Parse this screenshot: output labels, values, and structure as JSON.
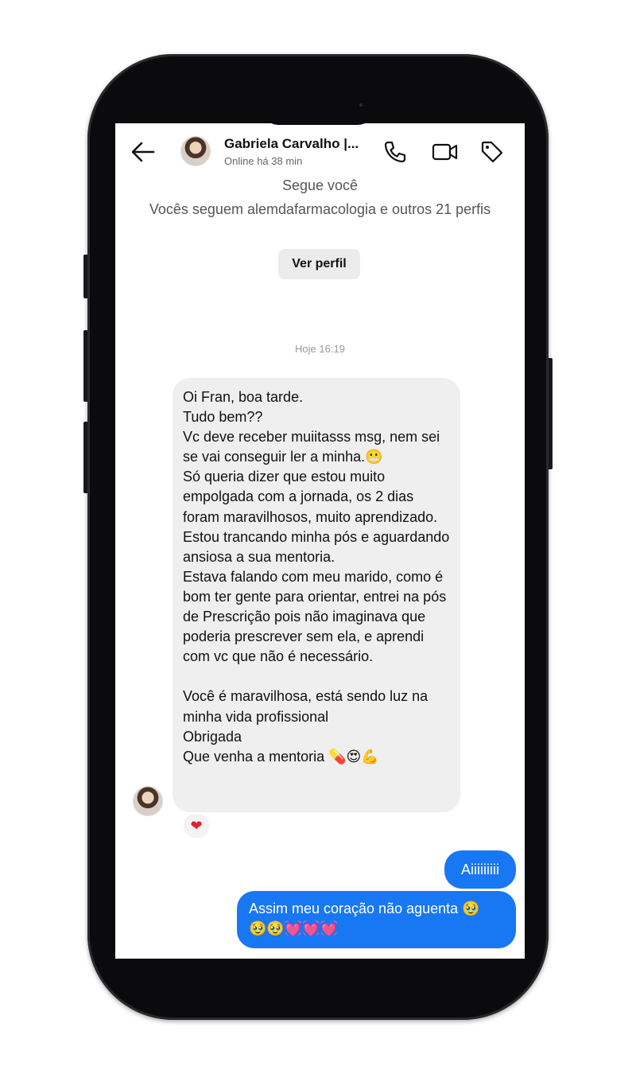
{
  "header": {
    "name": "Gabriela Carvalho |...",
    "status": "Online há 38 min"
  },
  "profile": {
    "follows_you": "Segue você",
    "mutual": "Vocês seguem alemdafarmacologia e outros 21 perfis",
    "view_profile_label": "Ver perfil"
  },
  "conversation": {
    "timestamp": "Hoje 16:19",
    "received_message": "Oi Fran, boa tarde.\nTudo bem??\nVc deve receber muiitasss msg, nem sei se vai conseguir ler a minha.😬\nSó queria dizer que estou muito empolgada com a jornada, os 2 dias foram maravilhosos, muito aprendizado.\nEstou trancando minha pós e aguardando ansiosa a sua mentoria.\nEstava falando com meu marido, como é bom ter gente para orientar, entrei na pós de Prescrição pois não imaginava que poderia prescrever sem ela, e aprendi com vc que não é necessário.\n\nVocê é maravilhosa, está sendo luz na minha vida profissional\nObrigada\nQue venha a mentoria 💊😍💪",
    "reaction": "❤",
    "sent_messages": [
      "Aiiiiiiiii",
      "Assim meu coração não aguenta 🥹\n🥹🥹💓💓💓"
    ]
  },
  "colors": {
    "sent_bubble": "#1877f2",
    "received_bubble": "#efefef",
    "phone_frame": "#0b0b0d"
  },
  "icons": [
    "back-arrow-icon",
    "phone-call-icon",
    "video-camera-icon",
    "tag-icon",
    "heart-icon"
  ]
}
